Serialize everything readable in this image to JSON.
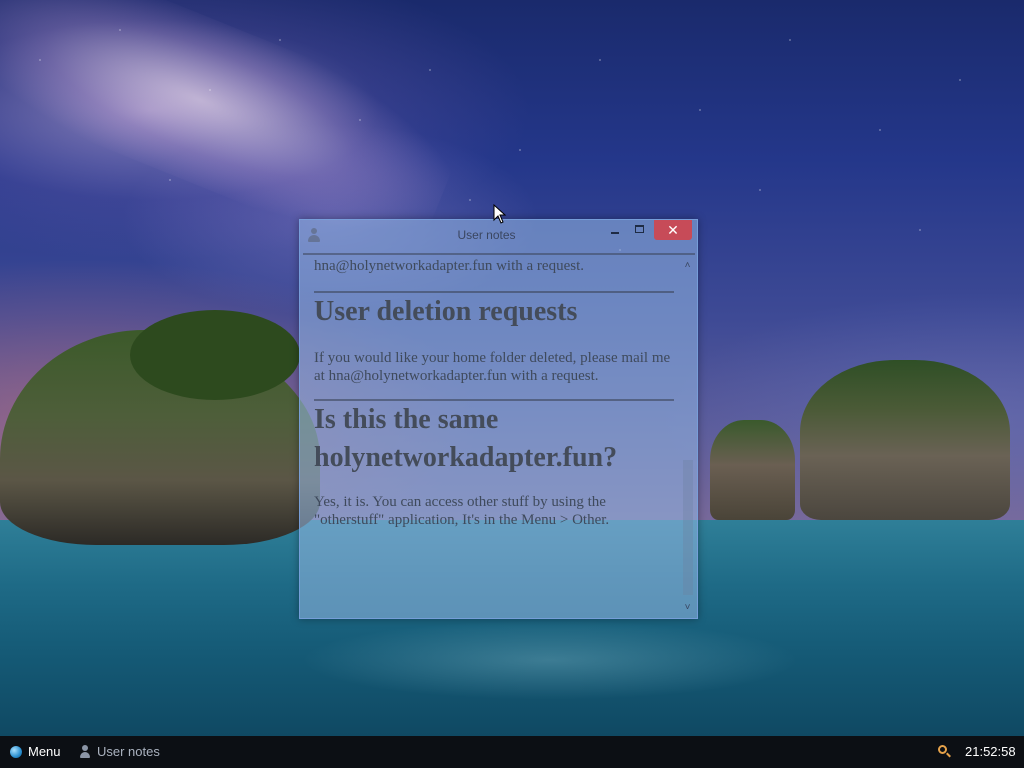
{
  "window": {
    "title": "User notes",
    "close_glyph": "✕",
    "content": {
      "paragraph_top": "your home directory is not allowed. Please mail me at hna@holynetworkadapter.fun with a request.",
      "heading_deletion": "User deletion requests",
      "paragraph_deletion": "If you would like your home folder deleted, please mail me at hna@holynetworkadapter.fun with a request.",
      "heading_same": "Is this the same holynetworkadapter.fun?",
      "paragraph_same": "Yes, it is. You can access other stuff by using the \"otherstuff\" application, It's in the Menu > Other."
    },
    "scroll_up_glyph": "˄",
    "scroll_down_glyph": "˅"
  },
  "taskbar": {
    "menu_label": "Menu",
    "task_label": "User notes",
    "clock": "21:52:58",
    "menu_icon": "globe-icon",
    "task_icon": "user-icon",
    "tray_icon": "search-icon"
  },
  "colors": {
    "close_button": "#c74b58",
    "taskbar": "#0c0f14",
    "search_icon": "#e6a24a"
  }
}
